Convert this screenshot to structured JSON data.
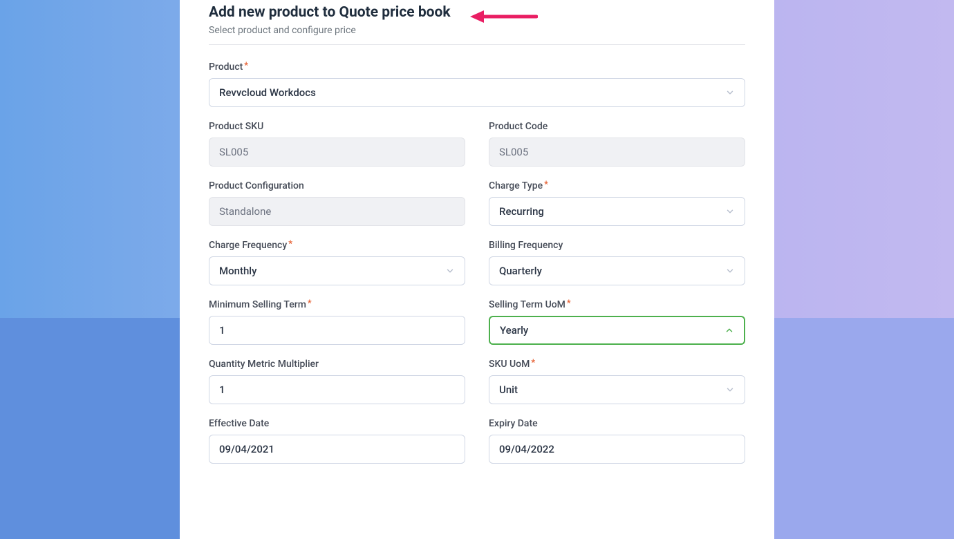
{
  "header": {
    "title": "Add new product to Quote price book",
    "subtitle": "Select product and configure price"
  },
  "fields": {
    "product": {
      "label": "Product",
      "value": "Revvcloud Workdocs",
      "required": true
    },
    "product_sku": {
      "label": "Product SKU",
      "value": "SL005"
    },
    "product_code": {
      "label": "Product Code",
      "value": "SL005"
    },
    "product_config": {
      "label": "Product Configuration",
      "value": "Standalone"
    },
    "charge_type": {
      "label": "Charge Type",
      "value": "Recurring",
      "required": true
    },
    "charge_frequency": {
      "label": "Charge Frequency",
      "value": "Monthly",
      "required": true
    },
    "billing_frequency": {
      "label": "Billing Frequency",
      "value": "Quarterly"
    },
    "min_selling_term": {
      "label": "Minimum Selling Term",
      "value": "1",
      "required": true
    },
    "selling_term_uom": {
      "label": "Selling Term UoM",
      "value": "Yearly",
      "required": true
    },
    "qty_metric_multiplier": {
      "label": "Quantity Metric Multiplier",
      "value": "1"
    },
    "sku_uom": {
      "label": "SKU UoM",
      "value": "Unit",
      "required": true
    },
    "effective_date": {
      "label": "Effective Date",
      "value": "09/04/2021"
    },
    "expiry_date": {
      "label": "Expiry Date",
      "value": "09/04/2022"
    }
  },
  "annotation": {
    "arrow_color": "#e91e63"
  }
}
